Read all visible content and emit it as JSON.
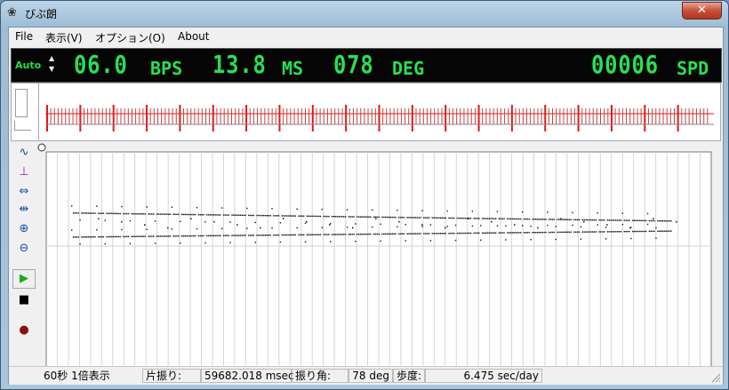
{
  "window": {
    "title": "びぶ朗",
    "close_label": "✕"
  },
  "menu": [
    {
      "label": "File"
    },
    {
      "label": "表示(V)"
    },
    {
      "label": "オプション(O)"
    },
    {
      "label": "About"
    }
  ],
  "lcd": {
    "mode": "Auto",
    "bps_value": "06.0",
    "bps_unit": "BPS",
    "ms_value": "13.8",
    "ms_unit": "MS",
    "deg_value": "078",
    "deg_unit": "DEG",
    "spd_value": "00006",
    "spd_unit": "SPD"
  },
  "status": {
    "span": "60秒 1倍表示",
    "half_label": "片振り:",
    "half_value": "59682.018 msec",
    "angle_label": "振り角:",
    "angle_value": "78 deg",
    "rate_label": "歩度:",
    "rate_value": "6.475 sec/day"
  },
  "colors": {
    "lcd_green": "#28e050",
    "wave_red": "#e01818"
  },
  "chart_data": {
    "type": "scatter",
    "series": [
      {
        "values_start": 3.0,
        "values_end": 3.4
      },
      {
        "values_start": 4.2,
        "values_end": 3.9
      }
    ],
    "grid": true
  }
}
